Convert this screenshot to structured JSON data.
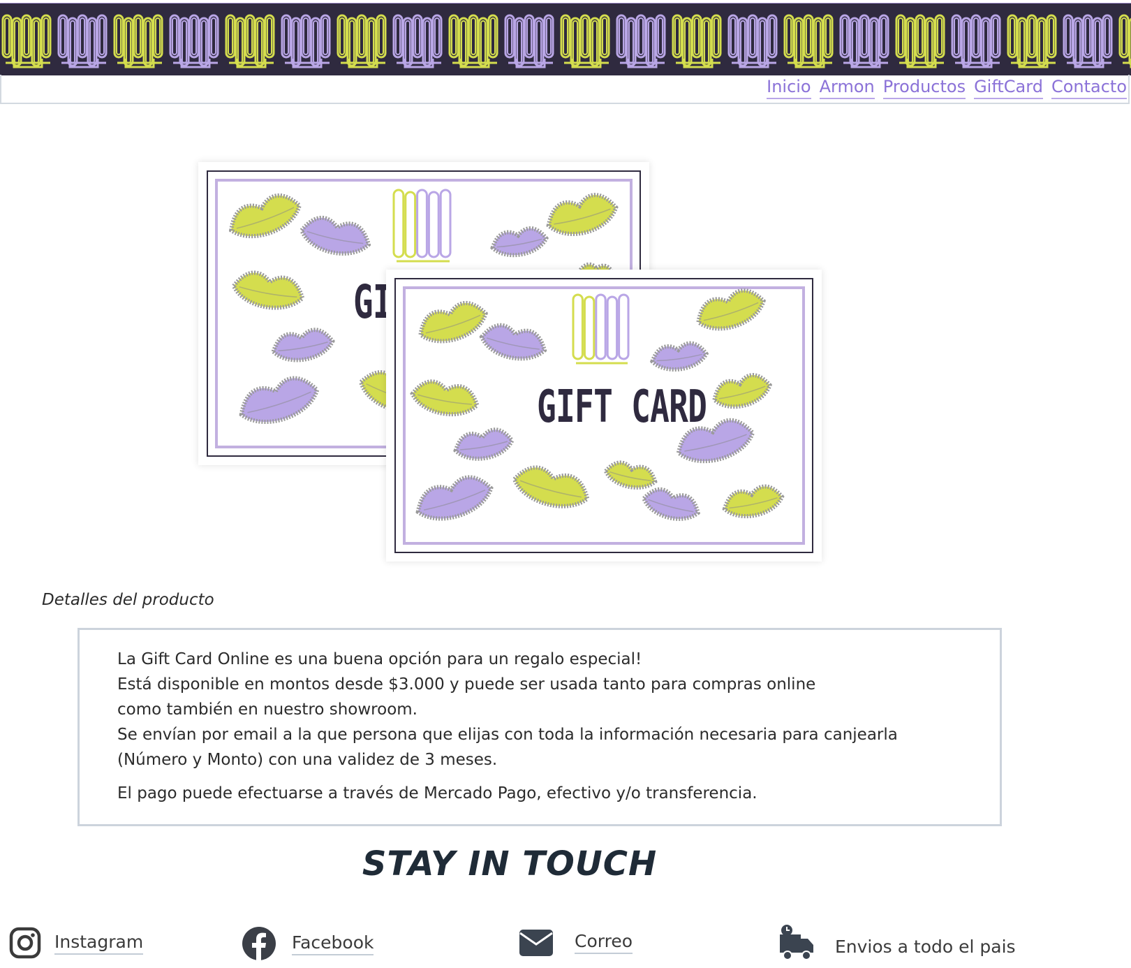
{
  "brand": {
    "logo_text": "ARMON",
    "lime": "#d4dd4e",
    "lavender": "#b9a6e6",
    "dark": "#2f2a3f"
  },
  "nav": {
    "items": [
      {
        "label": "Inicio"
      },
      {
        "label": "Armon"
      },
      {
        "label": "Productos"
      },
      {
        "label": "GiftCard"
      },
      {
        "label": "Contacto"
      }
    ]
  },
  "gift_cards": {
    "front_title": "GIFT CARD",
    "back_title_visible": "GI"
  },
  "details": {
    "label": "Detalles del producto",
    "lines": [
      "La Gift Card Online es una buena opción para un regalo especial!",
      "Está disponible en montos desde $3.000 y puede ser usada tanto para compras online",
      "como también en nuestro showroom.",
      "Se envían por email a la que persona que elijas con toda la información necesaria para canjearla",
      "(Número y Monto) con una validez de 3 meses.",
      "El pago puede efectuarse a través de Mercado Pago, efectivo y/o transferencia."
    ]
  },
  "footer": {
    "heading": "STAY IN TOUCH",
    "items": [
      {
        "label": "Instagram",
        "icon": "instagram-icon"
      },
      {
        "label": "Facebook",
        "icon": "facebook-icon"
      },
      {
        "label": "Correo",
        "icon": "mail-icon"
      },
      {
        "label": "Envios a todo el pais",
        "icon": "delivery-truck-icon"
      }
    ]
  }
}
